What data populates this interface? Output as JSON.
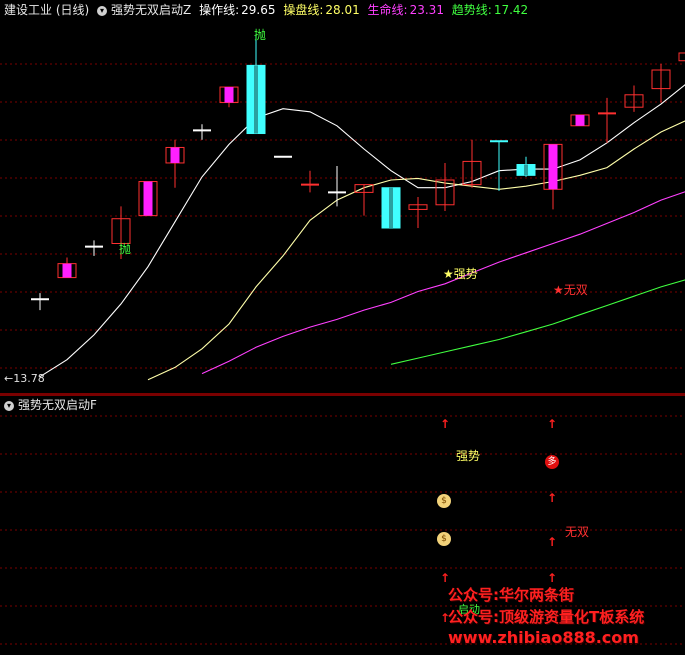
{
  "main_header": {
    "stock": "建设工业 (日线)",
    "indicator": "强势无双启动Z",
    "lines": [
      {
        "label": "操作线:",
        "value": "29.65",
        "color": "#ffffff"
      },
      {
        "label": "操盘线:",
        "value": "28.01",
        "color": "#ffff66"
      },
      {
        "label": "生命线:",
        "value": "23.31",
        "color": "#ff40ff"
      },
      {
        "label": "趋势线:",
        "value": "17.42",
        "color": "#40ff40"
      }
    ]
  },
  "sub_header": {
    "indicator": "强势无双启动F"
  },
  "low_marker": "←13.78",
  "annotations": {
    "throw_1": "抛",
    "throw_2": "抛",
    "strong": "★强势",
    "unmatched": "★无双"
  },
  "sub_annotations": {
    "strong": "强势",
    "unmatched": "无双",
    "start": "启动",
    "duo_badge": "多",
    "money_icon": "$"
  },
  "watermarks": {
    "line1": "公众号:华尔两条街",
    "line2": "公众号:顶级游资量化T板系统",
    "line3": "www.zhibiao888.com"
  },
  "chart_data": {
    "type": "candlestick",
    "ylim": [
      13.0,
      36.5
    ],
    "candles": [
      {
        "o": 18.6,
        "c": 18.6,
        "h": 19.0,
        "l": 17.9,
        "color": "white"
      },
      {
        "o": 20.0,
        "c": 20.9,
        "h": 21.3,
        "l": 20.0,
        "color": "magenta"
      },
      {
        "o": 22.0,
        "c": 22.0,
        "h": 22.4,
        "l": 21.4,
        "color": "white"
      },
      {
        "o": 22.2,
        "c": 23.8,
        "h": 24.6,
        "l": 21.2,
        "color": "red"
      },
      {
        "o": 24.0,
        "c": 26.2,
        "h": 26.2,
        "l": 24.0,
        "color": "magenta"
      },
      {
        "o": 27.4,
        "c": 28.4,
        "h": 28.9,
        "l": 25.8,
        "color": "magenta"
      },
      {
        "o": 29.5,
        "c": 29.5,
        "h": 29.9,
        "l": 28.9,
        "color": "white"
      },
      {
        "o": 31.3,
        "c": 32.3,
        "h": 32.3,
        "l": 31.0,
        "color": "magenta"
      },
      {
        "o": 33.7,
        "c": 29.3,
        "h": 35.6,
        "l": 29.3,
        "color": "cyan"
      },
      {
        "o": 27.8,
        "c": 27.8,
        "h": 27.8,
        "l": 27.8,
        "color": "white"
      },
      {
        "o": 26.0,
        "c": 26.0,
        "h": 26.9,
        "l": 25.5,
        "color": "red"
      },
      {
        "o": 25.5,
        "c": 25.5,
        "h": 27.2,
        "l": 24.6,
        "color": "white"
      },
      {
        "o": 25.5,
        "c": 26.0,
        "h": 26.0,
        "l": 24.0,
        "color": "red"
      },
      {
        "o": 25.8,
        "c": 23.2,
        "h": 25.8,
        "l": 23.2,
        "color": "cyan"
      },
      {
        "o": 24.4,
        "c": 24.7,
        "h": 25.2,
        "l": 23.2,
        "color": "red"
      },
      {
        "o": 24.7,
        "c": 26.3,
        "h": 27.4,
        "l": 24.3,
        "color": "red"
      },
      {
        "o": 26.0,
        "c": 27.5,
        "h": 28.9,
        "l": 25.8,
        "color": "red"
      },
      {
        "o": 28.8,
        "c": 28.8,
        "h": 28.8,
        "l": 25.6,
        "color": "cyan_line"
      },
      {
        "o": 26.6,
        "c": 27.3,
        "h": 27.8,
        "l": 26.5,
        "color": "cyan"
      },
      {
        "o": 28.6,
        "c": 25.7,
        "h": 28.6,
        "l": 24.4,
        "color": "magenta"
      },
      {
        "o": 30.5,
        "c": 29.8,
        "h": 30.5,
        "l": 29.8,
        "color": "magenta"
      },
      {
        "o": 30.6,
        "c": 30.6,
        "h": 31.6,
        "l": 28.7,
        "color": "red"
      },
      {
        "o": 31.0,
        "c": 31.8,
        "h": 32.4,
        "l": 30.7,
        "color": "red"
      },
      {
        "o": 32.2,
        "c": 33.4,
        "h": 33.8,
        "l": 31.3,
        "color": "red"
      },
      {
        "o": 34.0,
        "c": 34.5,
        "h": 35.3,
        "l": 32.5,
        "color": "red"
      }
    ],
    "series": [
      {
        "name": "操作线",
        "color": "#ffffff",
        "values": [
          13.6,
          14.7,
          16.3,
          18.3,
          20.7,
          23.6,
          26.5,
          28.6,
          30.3,
          30.9,
          30.7,
          29.8,
          28.3,
          26.9,
          25.8,
          25.8,
          26.2,
          26.9,
          27.0,
          27.0,
          27.6,
          28.7,
          30.0,
          31.2,
          32.6
        ]
      },
      {
        "name": "操盘线",
        "color": "#ffffaa",
        "values": [
          null,
          null,
          null,
          null,
          13.4,
          14.2,
          15.4,
          17.0,
          19.4,
          21.4,
          23.7,
          25.0,
          25.8,
          26.3,
          26.4,
          26.1,
          25.9,
          25.7,
          25.9,
          26.2,
          26.6,
          27.1,
          28.3,
          29.4,
          30.2
        ]
      },
      {
        "name": "生命线",
        "color": "#ff40ff",
        "values": [
          null,
          null,
          null,
          null,
          null,
          null,
          13.8,
          14.6,
          15.5,
          16.2,
          16.8,
          17.3,
          17.9,
          18.4,
          19.1,
          19.6,
          20.3,
          21.0,
          21.6,
          22.2,
          22.8,
          23.5,
          24.2,
          25.0,
          25.6
        ]
      },
      {
        "name": "趋势线",
        "color": "#40ff40",
        "values": [
          null,
          null,
          null,
          null,
          null,
          null,
          null,
          null,
          null,
          null,
          null,
          null,
          null,
          14.4,
          14.8,
          15.2,
          15.6,
          16.0,
          16.5,
          17.0,
          17.6,
          18.2,
          18.8,
          19.4,
          19.9
        ]
      }
    ],
    "grid": true
  }
}
